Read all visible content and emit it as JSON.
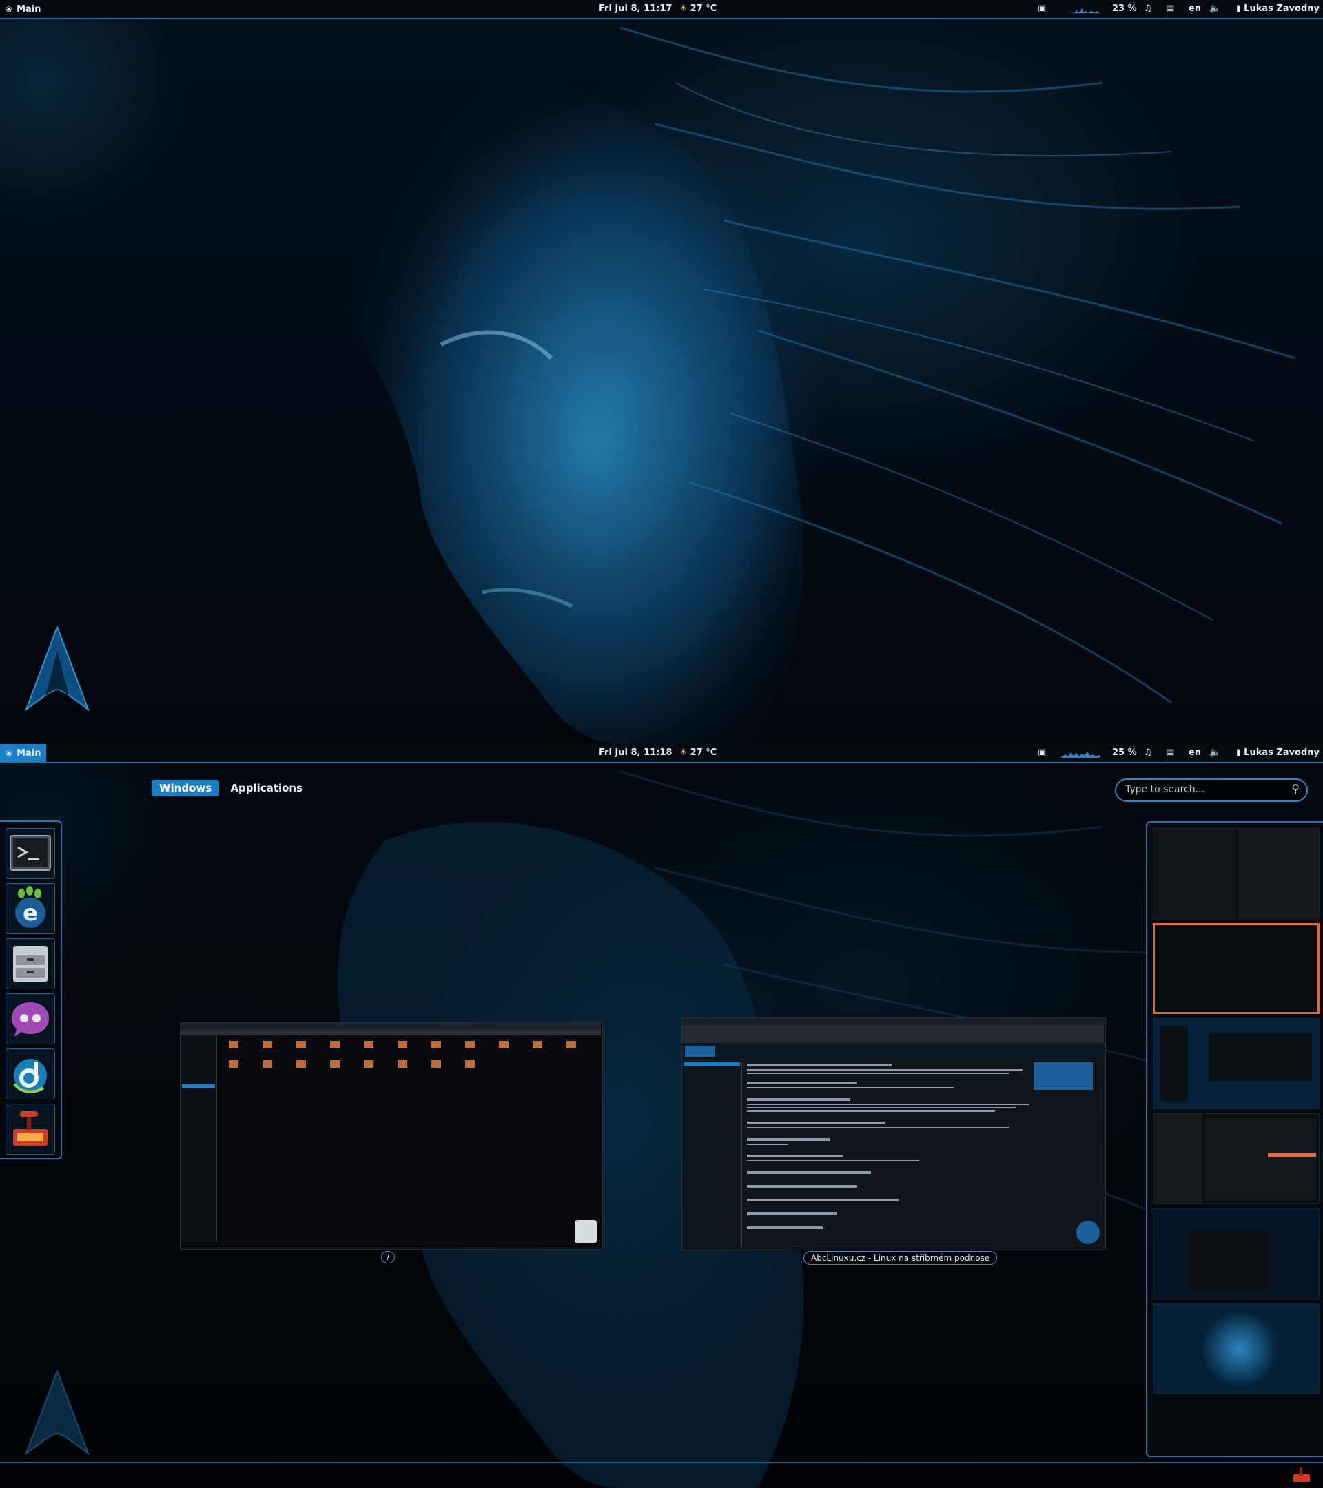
{
  "top_panel": {
    "activities_label": "Main",
    "clock": "Fri Jul  8, 11:17",
    "weather": "27 °C",
    "cpu": "23 %",
    "keyboard": "en",
    "user": "Lukas Zavodny"
  },
  "overview_panel": {
    "activities_label": "Main",
    "clock": "Fri Jul  8, 11:18",
    "weather": "27 °C",
    "cpu": "25 %",
    "keyboard": "en",
    "user": "Lukas Zavodny"
  },
  "overview": {
    "tabs": [
      "Windows",
      "Applications"
    ],
    "active_tab": "Windows",
    "search_placeholder": "Type to search..."
  },
  "dash": {
    "apps": [
      {
        "name": "terminal-icon"
      },
      {
        "name": "epiphany-browser-icon"
      },
      {
        "name": "file-manager-icon"
      },
      {
        "name": "empathy-chat-icon"
      },
      {
        "name": "deluge-torrent-icon"
      },
      {
        "name": "synaptic-package-icon"
      }
    ]
  },
  "windows": [
    {
      "caption": "/"
    },
    {
      "caption": "AbcLinuxu.cz - Linux na stříbrném podnose"
    }
  ],
  "workspaces": {
    "count": 6,
    "active": 2
  },
  "colors": {
    "accent": "#1a7ec4",
    "border": "#2474b0",
    "active_workspace": "#e06b33"
  }
}
